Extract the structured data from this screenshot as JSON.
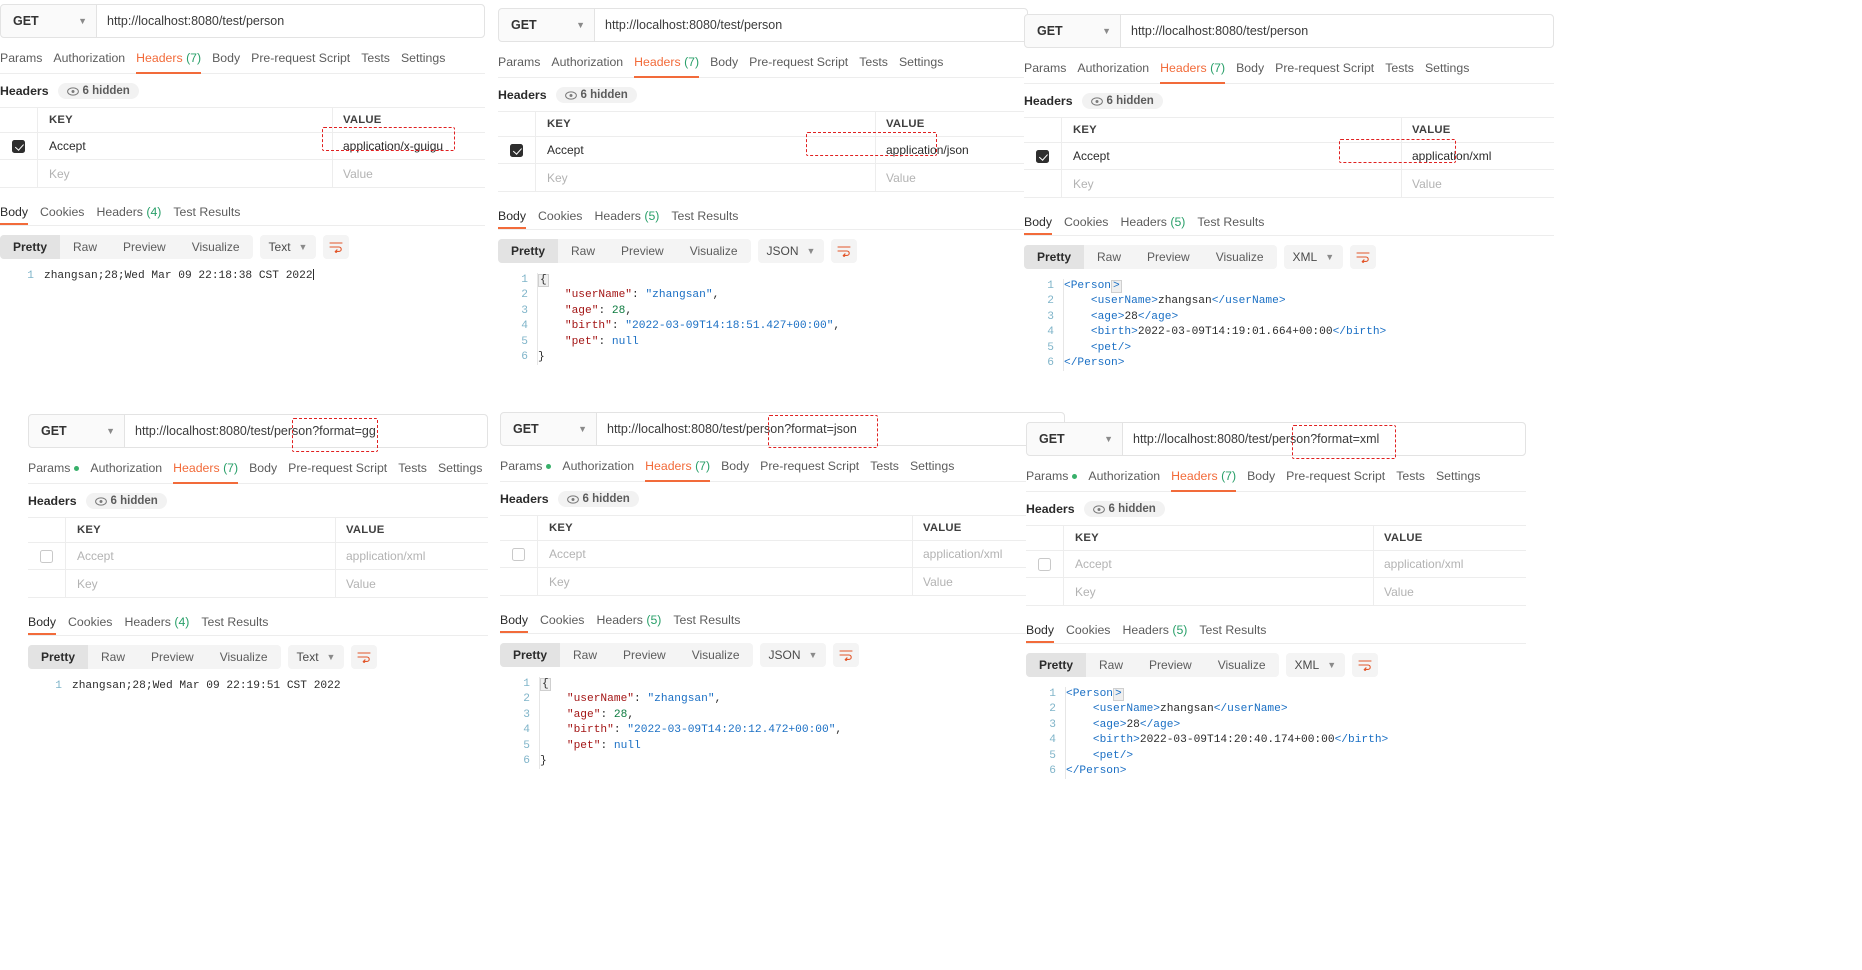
{
  "app": "Postman",
  "common": {
    "method": "GET",
    "request_tabs": [
      "Params",
      "Authorization",
      "Headers (7)",
      "Body",
      "Pre-request Script",
      "Tests",
      "Settings"
    ],
    "headers_label": "Headers",
    "hidden_pill": "6 hidden",
    "col_key": "KEY",
    "col_value": "VALUE",
    "key_placeholder": "Key",
    "value_placeholder": "Value",
    "accept_key": "Accept",
    "pretty_buttons": [
      "Pretty",
      "Raw",
      "Preview",
      "Visualize"
    ],
    "accent": "#f26b3a",
    "annotation_color": "#e02020",
    "green": "#2aa06a"
  },
  "panels": [
    {
      "id": "p1",
      "url": "http://localhost:8080/test/person",
      "query": "",
      "params_dot": false,
      "accept_checked": true,
      "accept_value": "application/x-guigu",
      "accept_value_highlighted": true,
      "response_tabs": [
        "Body",
        "Cookies",
        "Headers (4)",
        "Test Results"
      ],
      "format": "Text",
      "body_type": "text",
      "lines": [
        {
          "n": "1",
          "text": "zhangsan;28;Wed Mar 09 22:18:38 CST 2022"
        }
      ]
    },
    {
      "id": "p2",
      "url": "http://localhost:8080/test/person",
      "query": "",
      "params_dot": false,
      "accept_checked": true,
      "accept_value": "application/json",
      "accept_value_highlighted": true,
      "response_tabs": [
        "Body",
        "Cookies",
        "Headers (5)",
        "Test Results"
      ],
      "format": "JSON",
      "body_type": "json",
      "lines": [
        {
          "n": "1",
          "text": "{"
        },
        {
          "n": "2",
          "text": "    \"userName\": \"zhangsan\","
        },
        {
          "n": "3",
          "text": "    \"age\": 28,"
        },
        {
          "n": "4",
          "text": "    \"birth\": \"2022-03-09T14:18:51.427+00:00\","
        },
        {
          "n": "5",
          "text": "    \"pet\": null"
        },
        {
          "n": "6",
          "text": "}"
        }
      ]
    },
    {
      "id": "p3",
      "url": "http://localhost:8080/test/person",
      "query": "",
      "params_dot": false,
      "accept_checked": true,
      "accept_value": "application/xml",
      "accept_value_highlighted": true,
      "response_tabs": [
        "Body",
        "Cookies",
        "Headers (5)",
        "Test Results"
      ],
      "format": "XML",
      "body_type": "xml",
      "lines": [
        {
          "n": "1",
          "text": "<Person>"
        },
        {
          "n": "2",
          "text": "    <userName>zhangsan</userName>"
        },
        {
          "n": "3",
          "text": "    <age>28</age>"
        },
        {
          "n": "4",
          "text": "    <birth>2022-03-09T14:19:01.664+00:00</birth>"
        },
        {
          "n": "5",
          "text": "    <pet/>"
        },
        {
          "n": "6",
          "text": "</Person>"
        }
      ]
    },
    {
      "id": "p4",
      "url": "http://localhost:8080/test/person",
      "query": "?format=gg",
      "params_dot": true,
      "accept_checked": false,
      "accept_value": "application/xml",
      "accept_value_highlighted": false,
      "response_tabs": [
        "Body",
        "Cookies",
        "Headers (4)",
        "Test Results"
      ],
      "format": "Text",
      "body_type": "text",
      "lines": [
        {
          "n": "1",
          "text": "zhangsan;28;Wed Mar 09 22:19:51 CST 2022"
        }
      ]
    },
    {
      "id": "p5",
      "url": "http://localhost:8080/test/person",
      "query": "?format=json",
      "params_dot": true,
      "accept_checked": false,
      "accept_value": "application/xml",
      "accept_value_highlighted": false,
      "response_tabs": [
        "Body",
        "Cookies",
        "Headers (5)",
        "Test Results"
      ],
      "format": "JSON",
      "body_type": "json",
      "lines": [
        {
          "n": "1",
          "text": "{"
        },
        {
          "n": "2",
          "text": "    \"userName\": \"zhangsan\","
        },
        {
          "n": "3",
          "text": "    \"age\": 28,"
        },
        {
          "n": "4",
          "text": "    \"birth\": \"2022-03-09T14:20:12.472+00:00\","
        },
        {
          "n": "5",
          "text": "    \"pet\": null"
        },
        {
          "n": "6",
          "text": "}"
        }
      ]
    },
    {
      "id": "p6",
      "url": "http://localhost:8080/test/person",
      "query": "?format=xml",
      "params_dot": true,
      "accept_checked": false,
      "accept_value": "application/xml",
      "accept_value_highlighted": false,
      "response_tabs": [
        "Body",
        "Cookies",
        "Headers (5)",
        "Test Results"
      ],
      "format": "XML",
      "body_type": "xml",
      "lines": [
        {
          "n": "1",
          "text": "<Person>"
        },
        {
          "n": "2",
          "text": "    <userName>zhangsan</userName>"
        },
        {
          "n": "3",
          "text": "    <age>28</age>"
        },
        {
          "n": "4",
          "text": "    <birth>2022-03-09T14:20:40.174+00:00</birth>"
        },
        {
          "n": "5",
          "text": "    <pet/>"
        },
        {
          "n": "6",
          "text": "</Person>"
        }
      ]
    }
  ]
}
